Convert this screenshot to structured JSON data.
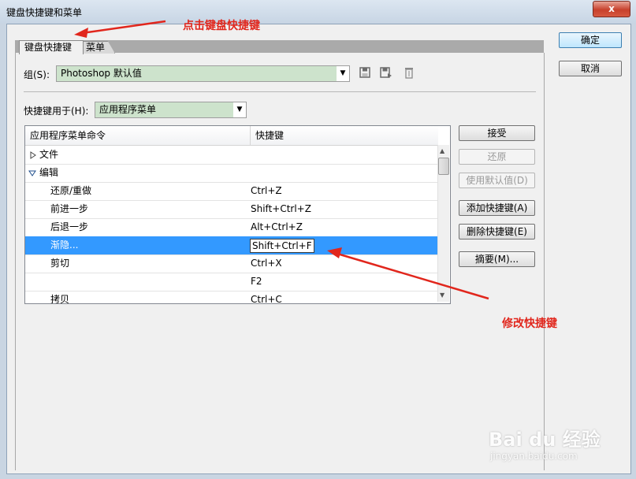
{
  "window": {
    "title": "键盘快捷键和菜单",
    "close_label": "x"
  },
  "tabs": [
    {
      "label": "键盘快捷键",
      "active": true
    },
    {
      "label": "菜单",
      "active": false
    }
  ],
  "group": {
    "label": "组(S):",
    "value": "Photoshop 默认值"
  },
  "shortcut_for": {
    "label": "快捷键用于(H):",
    "value": "应用程序菜单"
  },
  "table": {
    "headers": [
      "应用程序菜单命令",
      "快捷键"
    ],
    "rows": [
      {
        "command": "文件",
        "shortcut": "",
        "kind": "collapsed"
      },
      {
        "command": "编辑",
        "shortcut": "",
        "kind": "expanded"
      },
      {
        "command": "还原/重做",
        "shortcut": "Ctrl+Z",
        "kind": "item"
      },
      {
        "command": "前进一步",
        "shortcut": "Shift+Ctrl+Z",
        "kind": "item"
      },
      {
        "command": "后退一步",
        "shortcut": "Alt+Ctrl+Z",
        "kind": "item"
      },
      {
        "command": "渐隐...",
        "shortcut": "Shift+Ctrl+F",
        "kind": "selected"
      },
      {
        "command": "剪切",
        "shortcut": "Ctrl+X",
        "kind": "item"
      },
      {
        "command": "",
        "shortcut": "F2",
        "kind": "item"
      },
      {
        "command": "拷贝",
        "shortcut": "Ctrl+C",
        "kind": "item"
      }
    ]
  },
  "side_buttons": {
    "accept": "接受",
    "restore": "还原",
    "use_default": "使用默认值(D)",
    "add": "添加快捷键(A)",
    "delete": "删除快捷键(E)",
    "summary": "摘要(M)..."
  },
  "dialog_buttons": {
    "ok": "确定",
    "cancel": "取消"
  },
  "annotations": {
    "tab_hint": "点击键盘快捷键",
    "edit_hint": "修改快捷键"
  },
  "watermark": {
    "brand": "Bai du 经验",
    "url": "jingyan.baidu.com"
  },
  "colors": {
    "selection": "#3399ff",
    "annotation": "#e1261c",
    "combo_fill": "#cde3cc"
  }
}
